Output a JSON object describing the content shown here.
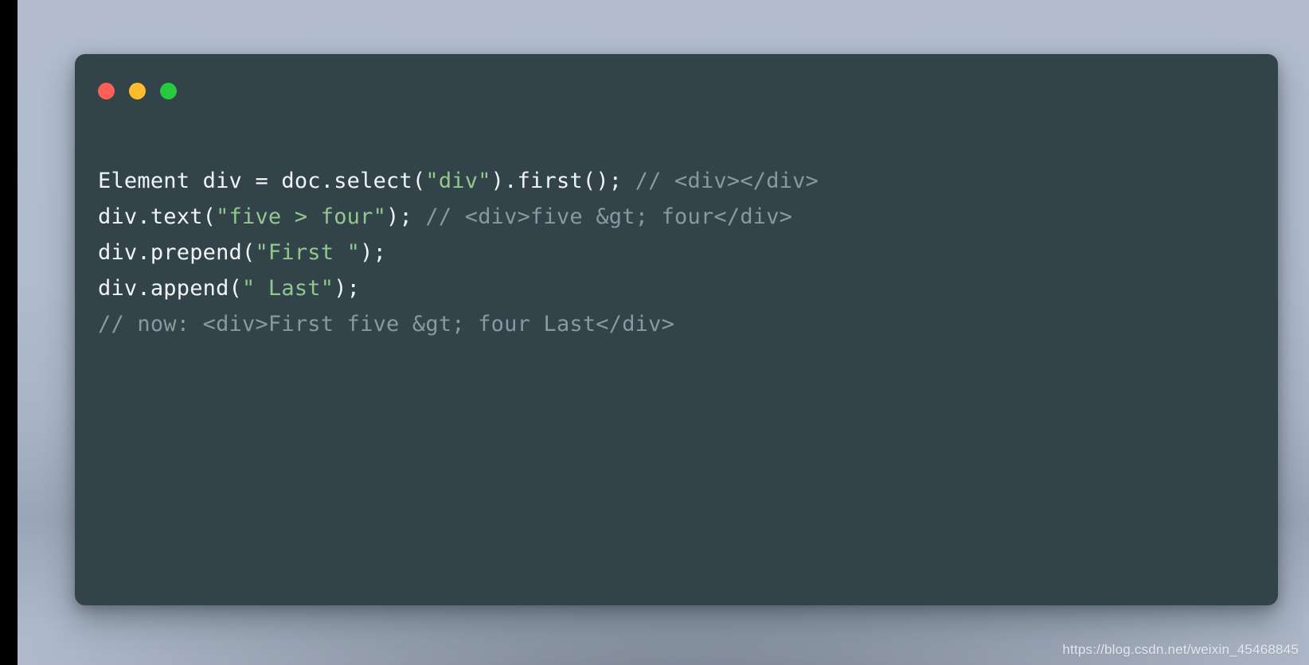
{
  "window": {
    "background_color": "#33434a",
    "controls": [
      {
        "name": "close",
        "color": "#ff5f56",
        "label": "Close"
      },
      {
        "name": "minimize",
        "color": "#ffbd2e",
        "label": "Minimize"
      },
      {
        "name": "maximize",
        "color": "#27c93f",
        "label": "Maximize"
      }
    ]
  },
  "theme": {
    "plain_color": "#f2f5f6",
    "string_color": "#93c78f",
    "comment_color": "#8a98a0",
    "page_background": "#aab5c5"
  },
  "code": {
    "language": "java",
    "lines": [
      {
        "index": 1,
        "plain_text": "Element div = doc.select(\"div\").first(); // <div></div>",
        "tokens": [
          {
            "type": "plain",
            "text": "Element div = doc.select("
          },
          {
            "type": "string",
            "text": "\"div\""
          },
          {
            "type": "plain",
            "text": ").first(); "
          },
          {
            "type": "comment",
            "text": "// <div></div>"
          }
        ]
      },
      {
        "index": 2,
        "plain_text": "div.text(\"five > four\"); // <div>five &gt; four</div>",
        "tokens": [
          {
            "type": "plain",
            "text": "div.text("
          },
          {
            "type": "string",
            "text": "\"five > four\""
          },
          {
            "type": "plain",
            "text": "); "
          },
          {
            "type": "comment",
            "text": "// <div>five &gt; four</div>"
          }
        ]
      },
      {
        "index": 3,
        "plain_text": "div.prepend(\"First \");",
        "tokens": [
          {
            "type": "plain",
            "text": "div.prepend("
          },
          {
            "type": "string",
            "text": "\"First \""
          },
          {
            "type": "plain",
            "text": ");"
          }
        ]
      },
      {
        "index": 4,
        "plain_text": "div.append(\" Last\");",
        "tokens": [
          {
            "type": "plain",
            "text": "div.append("
          },
          {
            "type": "string",
            "text": "\" Last\""
          },
          {
            "type": "plain",
            "text": ");"
          }
        ]
      },
      {
        "index": 5,
        "plain_text": "// now: <div>First five &gt; four Last</div>",
        "tokens": [
          {
            "type": "comment",
            "text": "// now: <div>First five &gt; four Last</div>"
          }
        ]
      }
    ]
  },
  "watermark": {
    "text": "https://blog.csdn.net/weixin_45468845"
  }
}
